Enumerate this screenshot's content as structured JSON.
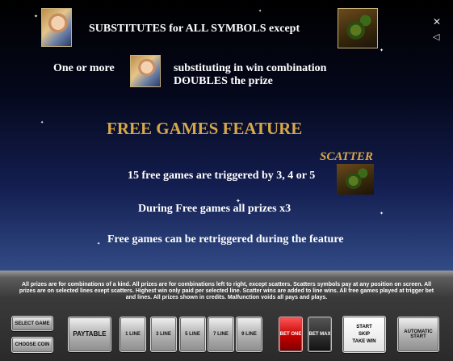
{
  "paytable": {
    "wild_line": "SUBSTITUTES for ALL SYMBOLS except",
    "one_or_more": "One or more",
    "substituting_line1": "substituting in win combination",
    "substituting_line2": "DOUBLES the prize",
    "feature_title": "FREE GAMES FEATURE",
    "scatter_label": "SCATTER",
    "trigger_text": "15 free games are triggered by 3, 4 or 5",
    "prizes_text": "During Free games all prizes x3",
    "retrigger_text": "Free games can be retriggered during the feature"
  },
  "side_icons": {
    "close": "close-x-icon",
    "sound": "speaker-icon"
  },
  "fine_print": "All prizes are for combinations of a kind. All prizes are for combinations left to right, except scatters. Scatters symbols pay at any position on screen. All prizes are on selected lines exept scatters. Highest win only paid per selected line. Scatter wins are added to line wins. All free games played at trigger bet and lines. All prizes shown in credits. Malfunction voids all pays and plays.",
  "buttons": {
    "select_game": "SELECT GAME",
    "choose_coin": "CHOOSE COIN",
    "paytable": "PAYTABLE",
    "line1": "1 LINE",
    "line3": "3 LINE",
    "line5": "5 LINE",
    "line7": "7 LINE",
    "line9": "9 LINE",
    "bet_one": "BET ONE",
    "bet_max": "BET MAX",
    "start": "START",
    "skip": "SKIP",
    "take_win": "TAKE WIN",
    "autostart": "AUTOMATIC START"
  },
  "colors": {
    "accent_gold": "#d7a84a",
    "bet_one_red": "#c40000"
  }
}
